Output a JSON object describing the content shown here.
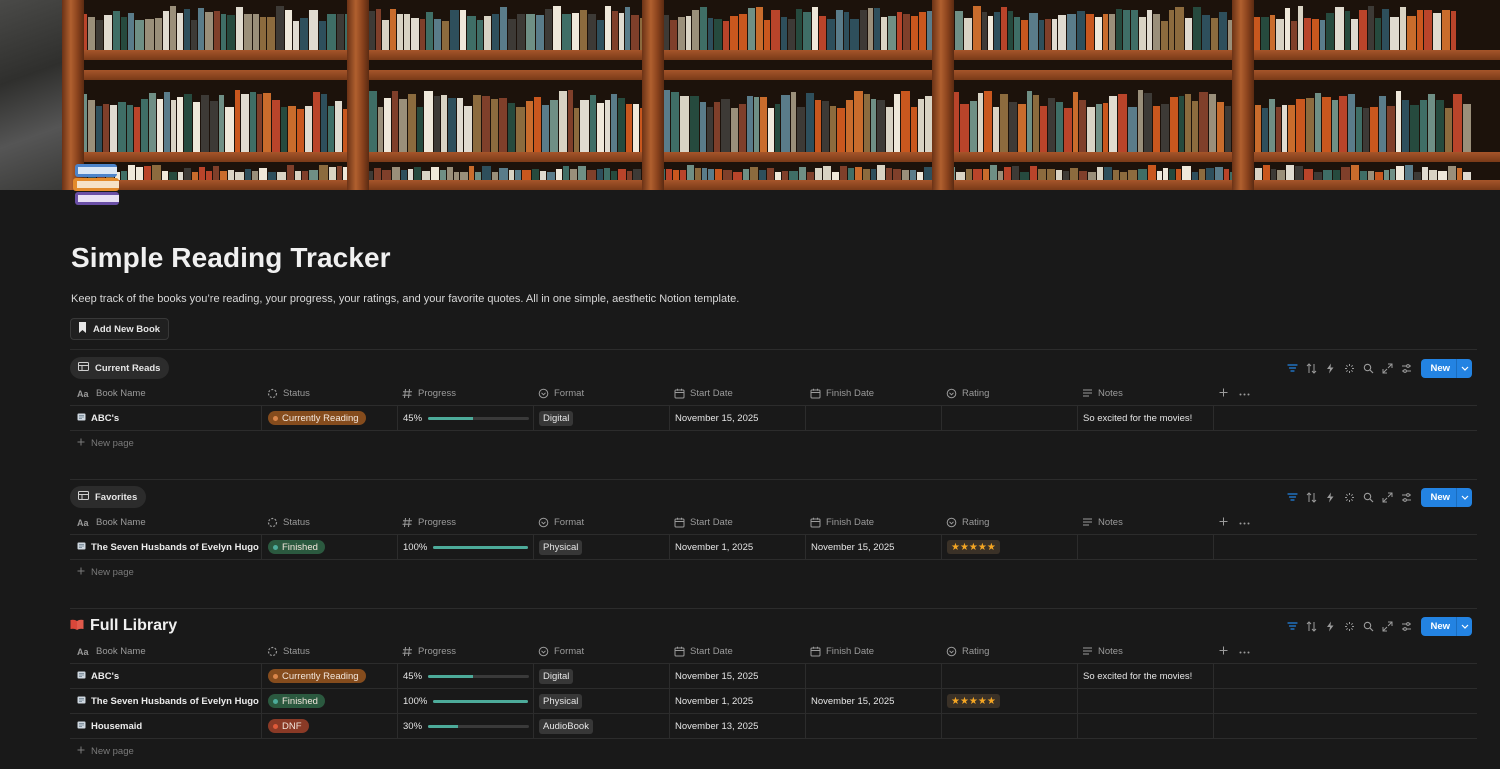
{
  "page": {
    "title": "Simple Reading Tracker",
    "description": "Keep track of the books you’re reading, your progress, your ratings, and your favorite quotes. All in one simple, aesthetic Notion template.",
    "add_button_label": "Add New Book",
    "page_icon": "books-icon"
  },
  "columns": {
    "name": "Book Name",
    "status": "Status",
    "progress": "Progress",
    "format": "Format",
    "start": "Start Date",
    "finish": "Finish Date",
    "rating": "Rating",
    "notes": "Notes"
  },
  "new_button_label": "New",
  "new_page_label": "New page",
  "status_colors": {
    "Currently Reading": {
      "bg": "#854c1d",
      "dot": "#d9864a"
    },
    "Finished": {
      "bg": "#2b593f",
      "dot": "#4dab9a"
    },
    "DNF": {
      "bg": "#8a3a26",
      "dot": "#de5a3a"
    }
  },
  "accent_color": "#2383e2",
  "current_reads": {
    "view_label": "Current Reads",
    "rows": [
      {
        "name": "ABC's",
        "status": "Currently Reading",
        "progress": "45%",
        "progress_value": 0.45,
        "format": "Digital",
        "start": "November 15, 2025",
        "finish": "",
        "rating": "",
        "notes": "So excited for the movies!"
      }
    ]
  },
  "favorites": {
    "view_label": "Favorites",
    "rows": [
      {
        "name": "The Seven Husbands of Evelyn Hugo",
        "status": "Finished",
        "progress": "100%",
        "progress_value": 1.0,
        "format": "Physical",
        "start": "November 1, 2025",
        "finish": "November 15, 2025",
        "rating": "★★★★★",
        "notes": ""
      }
    ]
  },
  "full_library": {
    "title": "Full Library",
    "rows": [
      {
        "name": "ABC's",
        "status": "Currently Reading",
        "progress": "45%",
        "progress_value": 0.45,
        "format": "Digital",
        "start": "November 15, 2025",
        "finish": "",
        "rating": "",
        "notes": "So excited for the movies!"
      },
      {
        "name": "The Seven Husbands of Evelyn Hugo",
        "status": "Finished",
        "progress": "100%",
        "progress_value": 1.0,
        "format": "Physical",
        "start": "November 1, 2025",
        "finish": "November 15, 2025",
        "rating": "★★★★★",
        "notes": ""
      },
      {
        "name": "Housemaid",
        "status": "DNF",
        "progress": "30%",
        "progress_value": 0.3,
        "format": "AudioBook",
        "start": "November 13, 2025",
        "finish": "",
        "rating": "",
        "notes": ""
      }
    ]
  }
}
